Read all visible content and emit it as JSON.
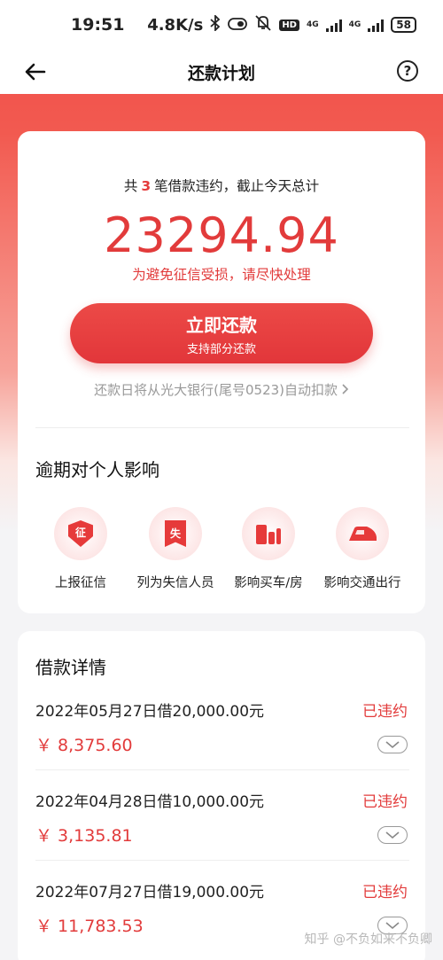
{
  "status_bar": {
    "time": "19:51",
    "speed": "4.8K/s",
    "net1": "4G",
    "net2": "4G",
    "hd": "HD",
    "battery": "58"
  },
  "nav": {
    "title": "还款计划",
    "help": "?"
  },
  "summary": {
    "prefix": "共",
    "count": "3",
    "suffix": "笔借款违约，截止今天总计",
    "total": "23294.94",
    "warning": "为避免征信受损，请尽快处理",
    "pay_button_label": "立即还款",
    "pay_button_sub": "支持部分还款",
    "auto_deduct": "还款日将从光大银行(尾号0523)自动扣款"
  },
  "impact": {
    "title": "逾期对个人影响",
    "items": [
      {
        "label": "上报征信",
        "glyph": "征"
      },
      {
        "label": "列为失信人员",
        "glyph": "失"
      },
      {
        "label": "影响买车/房",
        "glyph": ""
      },
      {
        "label": "影响交通出行",
        "glyph": ""
      }
    ]
  },
  "details": {
    "title": "借款详情",
    "loans": [
      {
        "desc": "2022年05月27日借20,000.00元",
        "status": "已违约",
        "amount": "￥ 8,375.60"
      },
      {
        "desc": "2022年04月28日借10,000.00元",
        "status": "已违约",
        "amount": "￥ 3,135.81"
      },
      {
        "desc": "2022年07月27日借19,000.00元",
        "status": "已违约",
        "amount": "￥ 11,783.53"
      }
    ]
  },
  "watermark": "知乎 @不负如来不负卿",
  "colors": {
    "accent_red": "#e23b3b",
    "header_red": "#f04a48"
  }
}
